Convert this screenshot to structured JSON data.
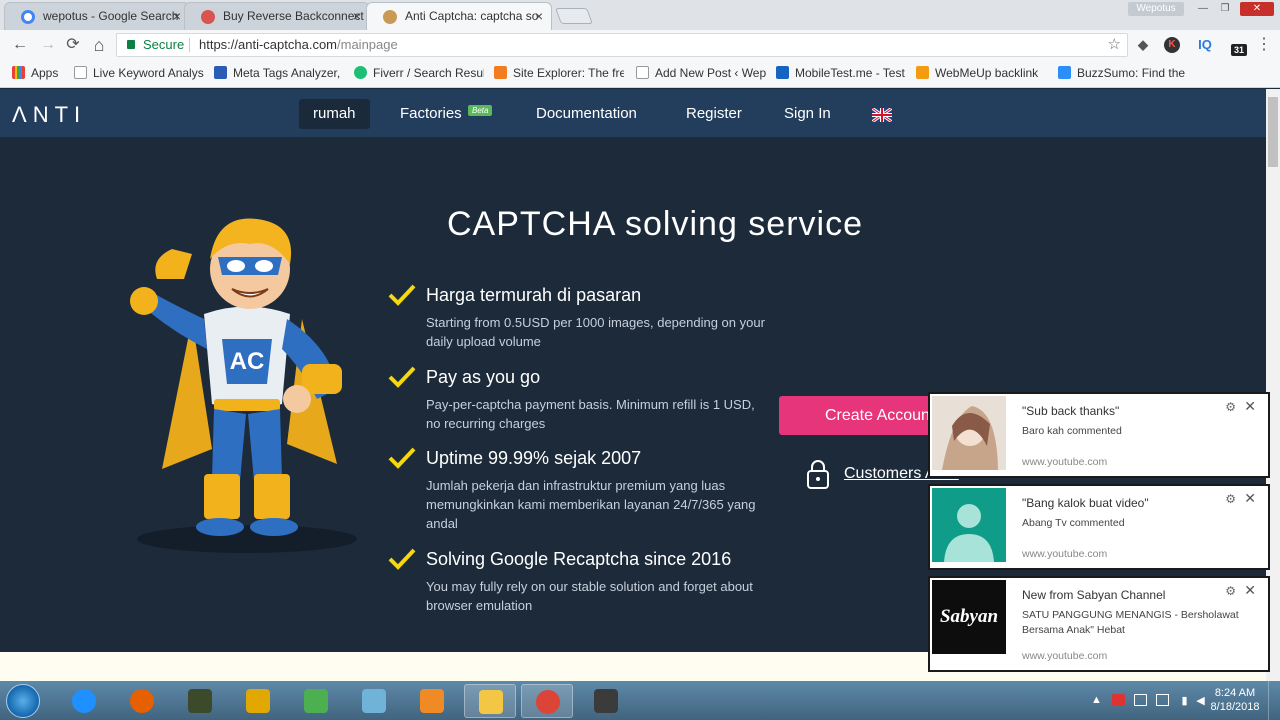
{
  "browser": {
    "tabs": [
      {
        "title": "wepotus - Google Search",
        "close": "×",
        "favicon_color": "#4285f4"
      },
      {
        "title": "Buy Reverse Backconnect",
        "close": "×",
        "favicon_color": "#d9534f"
      },
      {
        "title": "Anti Captcha: captcha so",
        "close": "×",
        "favicon_color": "#c99a55"
      }
    ],
    "profile_name": "Wepotus",
    "window_buttons": {
      "minimize": "—",
      "maximize": "❐",
      "close": "✕"
    },
    "nav": {
      "back": "←",
      "forward": "→",
      "reload": "⟳",
      "home": "⌂"
    },
    "security_label": "Secure",
    "url_host": "https://anti-captcha.com",
    "url_path": "/mainpage",
    "star": "☆",
    "extensions": [
      {
        "name": "eraser-extension-icon",
        "glyph": "◆",
        "color": "#555"
      },
      {
        "name": "profile-k-extension-icon",
        "glyph": "K",
        "color": "#b33"
      },
      {
        "name": "iq-extension-icon",
        "glyph": "IQ",
        "color": "#2a7ae2"
      },
      {
        "name": "calendar-extension-icon",
        "glyph": "31",
        "color": "#222"
      }
    ],
    "bookmarks": [
      {
        "label": "Apps",
        "color": "#e94235"
      },
      {
        "label": "Live Keyword Analysis",
        "color": "#bbb"
      },
      {
        "label": "Meta Tags Analyzer,",
        "color": "#2a5bb5"
      },
      {
        "label": "Fiverr / Search Result",
        "color": "#1dbf73"
      },
      {
        "label": "Site Explorer: The fre",
        "color": "#f47c20"
      },
      {
        "label": "Add New Post ‹ Wep",
        "color": "#bbb"
      },
      {
        "label": "MobileTest.me - Test",
        "color": "#1565c0"
      },
      {
        "label": "WebMeUp backlink",
        "color": "#f39c12"
      },
      {
        "label": "BuzzSumo: Find the",
        "color": "#2c8ef8"
      }
    ]
  },
  "site": {
    "logo": "ΛΝΤΙ",
    "nav": [
      {
        "label": "rumah",
        "active": true
      },
      {
        "label": "Factories",
        "active": false
      },
      {
        "label": "Documentation",
        "active": false
      },
      {
        "label": "Register",
        "active": false
      },
      {
        "label": "Sign In",
        "active": false
      }
    ],
    "beta_badge": "Beta",
    "headline": "CAPTCHA solving service",
    "mascot_chest_text": "AC",
    "features": [
      {
        "title": "Harga termurah di pasaran",
        "desc": "Starting from 0.5USD per 1000 images, depending on your daily upload volume"
      },
      {
        "title": "Pay as you go",
        "desc": "Pay-per-captcha payment basis. Minimum refill is 1 USD, no recurring charges"
      },
      {
        "title": "Uptime 99.99% sejak 2007",
        "desc": "Jumlah pekerja dan infrastruktur premium yang luas memungkinkan kami memberikan layanan 24/7/365 yang andal"
      },
      {
        "title": "Solving Google Recaptcha since 2016",
        "desc": "You may fully rely on our stable solution and forget about browser emulation"
      }
    ],
    "cta_button": "Create Account",
    "customers_link": "Customers Area",
    "colors": {
      "nav_bg": "#233d5c",
      "page_bg": "#1c2a3a",
      "cta": "#e6357a",
      "check": "#f5d90a"
    }
  },
  "notifications": [
    {
      "title": "\"Sub back thanks\"",
      "body": "Baro kah commented",
      "source": "www.youtube.com",
      "gear": "⚙",
      "close": "✕"
    },
    {
      "title": "\"Bang kalok buat video\"",
      "body": "Abang Tv commented",
      "source": "www.youtube.com",
      "gear": "⚙",
      "close": "✕"
    },
    {
      "title": "New from Sabyan Channel",
      "body": "SATU PANGGUNG MENANGIS - Bersholawat Bersama Anak\" Hebat",
      "source": "www.youtube.com",
      "gear": "⚙",
      "close": "✕",
      "thumb_text": "Sabyan"
    }
  ],
  "taskbar": {
    "apps": [
      {
        "name": "internet-explorer-taskbar-icon",
        "color": "#1e90ff"
      },
      {
        "name": "firefox-taskbar-icon",
        "color": "#e66000"
      },
      {
        "name": "app3-taskbar-icon",
        "color": "#3a4a2a"
      },
      {
        "name": "headphones-taskbar-icon",
        "color": "#e0a800"
      },
      {
        "name": "app5-taskbar-icon",
        "color": "#4caf50"
      },
      {
        "name": "app6-taskbar-icon",
        "color": "#6fb3d8"
      },
      {
        "name": "media-player-taskbar-icon",
        "color": "#f08a24"
      },
      {
        "name": "file-explorer-taskbar-icon",
        "color": "#f3c745"
      },
      {
        "name": "chrome-taskbar-icon",
        "color": "#db4437"
      },
      {
        "name": "app10-taskbar-icon",
        "color": "#3b3b3b"
      }
    ],
    "time": "8:24 AM",
    "date": "8/18/2018"
  }
}
